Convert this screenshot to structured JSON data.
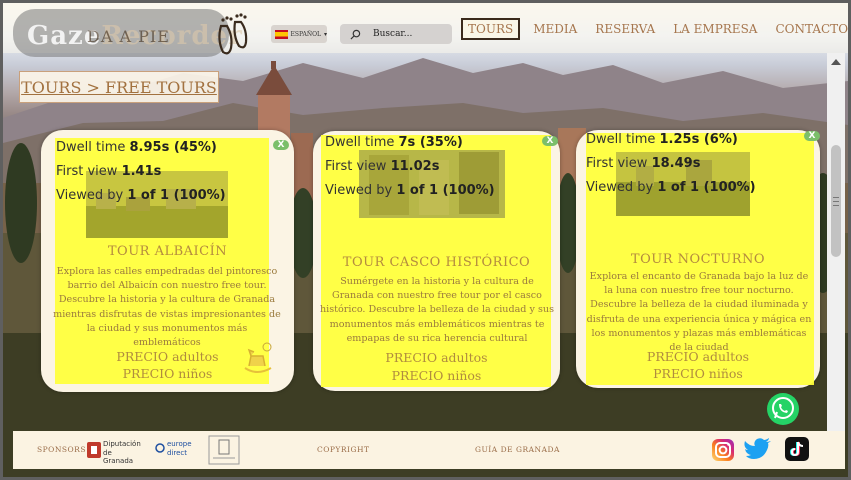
{
  "header": {
    "logo_text_a": "Gaze",
    "logo_text_b": "Recorder",
    "logo_text_c": "DA A PIE",
    "language_label": "ESPAÑOL",
    "search_placeholder": "Buscar...",
    "nav": [
      {
        "label": "TOURS",
        "active": true
      },
      {
        "label": "MEDIA",
        "active": false
      },
      {
        "label": "RESERVA",
        "active": false
      },
      {
        "label": "LA EMPRESA",
        "active": false
      },
      {
        "label": "CONTACTO",
        "active": false
      }
    ]
  },
  "breadcrumb": "TOURS > FREE TOURS",
  "cards": [
    {
      "dwell_time_label": "Dwell time",
      "dwell_time_value": "8.95s (45%)",
      "first_view_label": "First view",
      "first_view_value": "1.41s",
      "viewed_by_label": "Viewed by",
      "viewed_by_value": "1 of 1 (100%)",
      "close_label": "X",
      "title": "TOUR ALBAICÍN",
      "description": "Explora las calles empedradas del pintoresco barrio del Albaicín con nuestro free tour. Descubre la historia y la cultura de Granada mientras disfrutas de vistas impresionantes de la ciudad y sus monumentos más emblemáticos",
      "price_adults": "PRECIO adultos",
      "price_kids": "PRECIO niños"
    },
    {
      "dwell_time_label": "Dwell time",
      "dwell_time_value": "7s (35%)",
      "first_view_label": "First view",
      "first_view_value": "11.02s",
      "viewed_by_label": "Viewed by",
      "viewed_by_value": "1 of 1 (100%)",
      "close_label": "X",
      "title": "TOUR CASCO HISTÓRICO",
      "description": "Sumérgete en la historia y la cultura de Granada con nuestro free tour por el casco histórico. Descubre la belleza de la ciudad y sus monumentos más emblemáticos mientras te empapas de su rica herencia cultural",
      "price_adults": "PRECIO adultos",
      "price_kids": "PRECIO niños"
    },
    {
      "dwell_time_label": "Dwell time",
      "dwell_time_value": "1.25s (6%)",
      "first_view_label": "First view",
      "first_view_value": "18.49s",
      "viewed_by_label": "Viewed by",
      "viewed_by_value": "1 of 1 (100%)",
      "close_label": "X",
      "title": "TOUR NOCTURNO",
      "description": "Explora el encanto de Granada bajo la luz de la luna con nuestro free tour nocturno. Descubre la belleza de la ciudad iluminada y disfruta de una experiencia única y mágica en los monumentos y plazas más emblemáticas de la ciudad",
      "price_adults": "PRECIO adultos",
      "price_kids": "PRECIO niños"
    }
  ],
  "footer": {
    "sponsors_label": "SPONSORS",
    "sponsor_diputacion_line1": "Diputación",
    "sponsor_diputacion_line2": "de Granada",
    "sponsor_europe_line1": "europe",
    "sponsor_europe_line2": "direct",
    "copyright": "COPYRIGHT",
    "guide": "GUÍA DE GRANADA"
  },
  "colors": {
    "accent_brown": "#a6764e",
    "highlight_yellow": "#ffff3a",
    "whatsapp_green": "#25d366",
    "twitter_blue": "#1da1f2"
  },
  "icons": {
    "logo": "footprints-icon",
    "search": "search-icon",
    "whatsapp": "whatsapp-icon",
    "instagram": "instagram-icon",
    "twitter": "twitter-icon",
    "tiktok": "tiktok-icon"
  }
}
